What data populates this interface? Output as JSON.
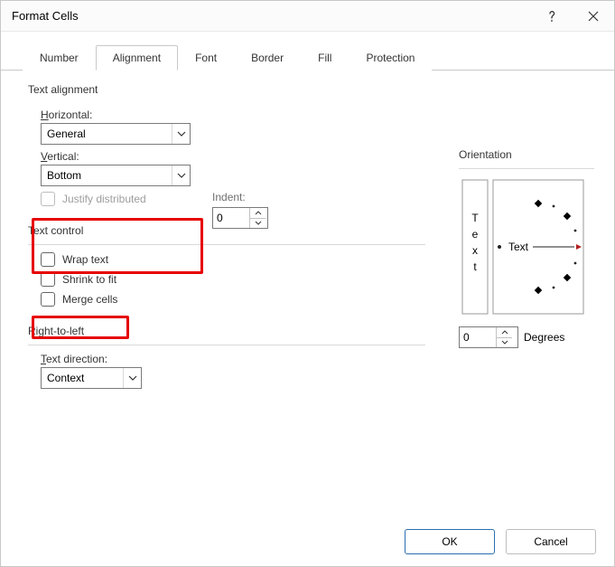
{
  "title": "Format Cells",
  "tabs": [
    "Number",
    "Alignment",
    "Font",
    "Border",
    "Fill",
    "Protection"
  ],
  "active_tab": "Alignment",
  "groups": {
    "text_alignment": "Text alignment",
    "text_control": "Text control",
    "rtl": "Right-to-left",
    "orientation": "Orientation"
  },
  "align": {
    "horizontal_label": "Horizontal:",
    "horizontal_value": "General",
    "vertical_label": "Vertical:",
    "vertical_value": "Bottom",
    "indent_label": "Indent:",
    "indent_value": "0",
    "justify_distributed": "Justify distributed"
  },
  "control": {
    "wrap": "Wrap text",
    "shrink": "Shrink to fit",
    "merge": "Merge cells"
  },
  "rtl": {
    "direction_label": "Text direction:",
    "direction_value": "Context"
  },
  "orient": {
    "vtext": "T e x t",
    "htext": "Text",
    "degrees_value": "0",
    "degrees_label": "Degrees"
  },
  "buttons": {
    "ok": "OK",
    "cancel": "Cancel"
  }
}
